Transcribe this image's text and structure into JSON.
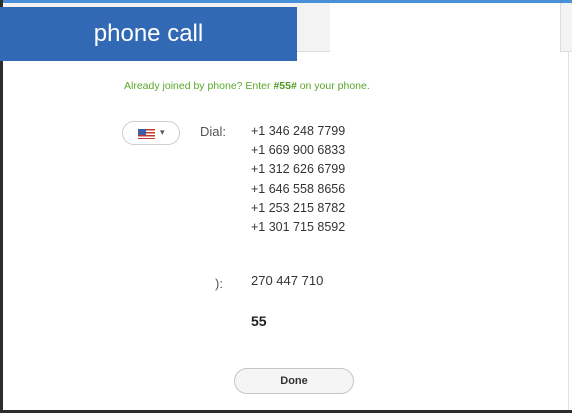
{
  "banner": {
    "title": "phone call"
  },
  "dialog": {
    "hint_prefix": "Already joined by phone? Enter ",
    "hint_code": "#55#",
    "hint_suffix": " on your phone.",
    "country": {
      "flag_icon": "us-flag-icon",
      "selected": "United States"
    },
    "dial_label": "Dial:",
    "numbers": [
      "+1 346 248 7799",
      "+1 669 900 6833",
      "+1 312 626 6799",
      "+1 646 558 8656",
      "+1 253 215 8782",
      "+1 301 715 8592"
    ],
    "meeting_id_label": "):",
    "meeting_id": "270 447 710",
    "participant_id": "55",
    "done_label": "Done"
  },
  "colors": {
    "banner": "#3169b4",
    "hint": "#5aa82a",
    "accent_line": "#4a90d9"
  }
}
